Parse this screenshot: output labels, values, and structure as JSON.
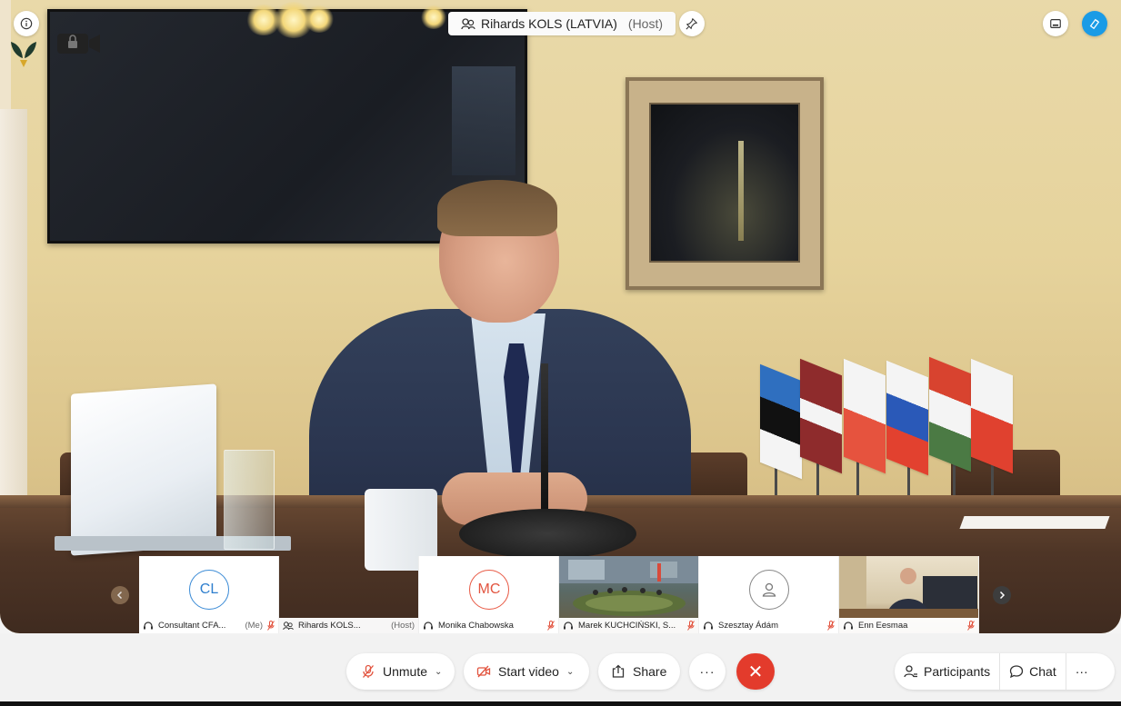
{
  "header": {
    "host_name": "Rihards KOLS (LATVIA)",
    "host_role": "(Host)"
  },
  "filmstrip": {
    "tiles": [
      {
        "initials": "CL",
        "name": "Consultant CFA...",
        "tag": "(Me)"
      },
      {
        "initials": "",
        "name": "Rihards KOLS...",
        "tag": "(Host)"
      },
      {
        "initials": "MC",
        "name": "Monika Chabowska",
        "tag": ""
      },
      {
        "initials": "",
        "name": "Marek KUCHCIŃSKI, S...",
        "tag": ""
      },
      {
        "initials": "",
        "name": "Szesztay Ádám",
        "tag": ""
      },
      {
        "initials": "",
        "name": "Enn Eesmaa",
        "tag": ""
      }
    ],
    "prev_icon": "chevron-left-icon",
    "next_icon": "chevron-right-icon"
  },
  "toolbar": {
    "unmute_label": "Unmute",
    "start_video_label": "Start video",
    "share_label": "Share",
    "more_label": "···",
    "leave_label": "✕",
    "participants_label": "Participants",
    "chat_label": "Chat",
    "overflow_label": "···"
  },
  "colors": {
    "accent_blue": "#1a9be6",
    "leave_red": "#e33b2c",
    "avatar_cl": "#2f7fce",
    "avatar_mc": "#e2543f",
    "muted_red": "#e2543f"
  }
}
